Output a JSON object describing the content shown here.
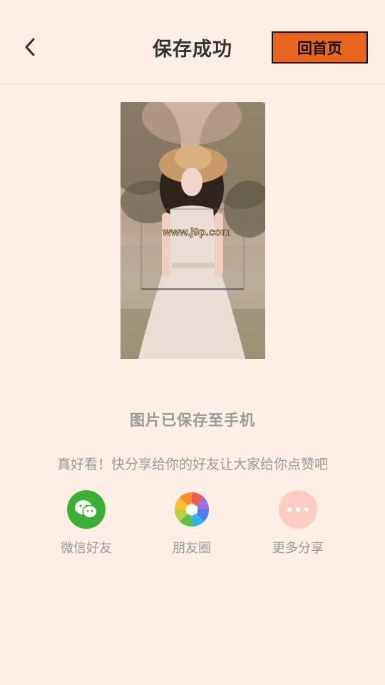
{
  "header": {
    "title": "保存成功",
    "home_button_label": "回首页",
    "home_button_color": "#e8661c"
  },
  "preview": {
    "watermark": "www.j9p.com"
  },
  "status": {
    "saved_message": "图片已保存至手机",
    "share_hint": "真好看！快分享给你的好友让大家给你点赞吧"
  },
  "share": {
    "items": [
      {
        "label": "微信好友",
        "icon": "wechat-icon",
        "color": "#3cb034"
      },
      {
        "label": "朋友圈",
        "icon": "moments-icon",
        "color": "multicolor"
      },
      {
        "label": "更多分享",
        "icon": "more-icon",
        "color": "#fdccc4"
      }
    ]
  },
  "colors": {
    "background": "#fdeee6",
    "accent": "#e8661c"
  }
}
